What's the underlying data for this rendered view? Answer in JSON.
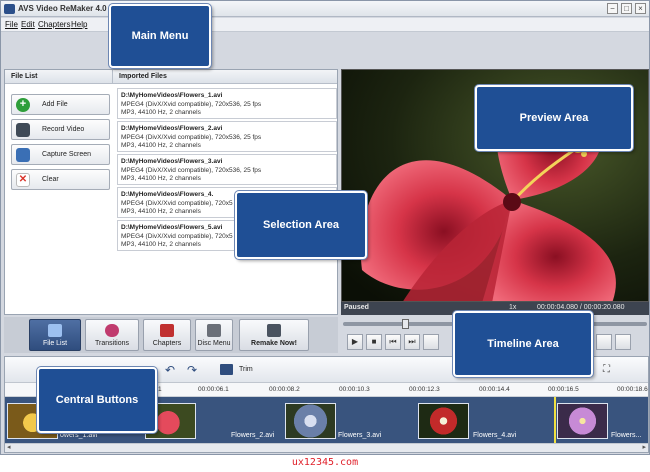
{
  "window": {
    "title": "AVS Video ReMaker 4.0",
    "minimize_glyph": "−",
    "maximize_glyph": "□",
    "close_glyph": "×"
  },
  "menu": [
    "File",
    "Edit",
    "Chapters",
    "Help"
  ],
  "file_list": {
    "header": "File List",
    "buttons": [
      {
        "label": "Add File",
        "icon": "plus-icon",
        "color": "#2e9e3a"
      },
      {
        "label": "Record Video",
        "icon": "film-icon",
        "color": "#3f4a57"
      },
      {
        "label": "Capture Screen",
        "icon": "monitor-icon",
        "color": "#3a6fb5"
      },
      {
        "label": "Clear",
        "icon": "clear-icon",
        "color": "#d9342b"
      }
    ]
  },
  "imported_files": {
    "header": "Imported Files",
    "items": [
      {
        "path": "D:\\MyHomeVideos\\Flowers_1.avi",
        "video": "MPEG4 (DivX/Xvid compatible), 720x536, 25 fps",
        "audio": "MP3, 44100 Hz, 2 channels"
      },
      {
        "path": "D:\\MyHomeVideos\\Flowers_2.avi",
        "video": "MPEG4 (DivX/Xvid compatible), 720x536, 25 fps",
        "audio": "MP3, 44100 Hz, 2 channels"
      },
      {
        "path": "D:\\MyHomeVideos\\Flowers_3.avi",
        "video": "MPEG4 (DivX/Xvid compatible), 720x536, 25 fps",
        "audio": "MP3, 44100 Hz, 2 channels"
      },
      {
        "path": "D:\\MyHomeVideos\\Flowers_4.",
        "video": "MPEG4 (DivX/Xvid compatible), 720x5",
        "audio": "MP3, 44100 Hz, 2 channels"
      },
      {
        "path": "D:\\MyHomeVideos\\Flowers_5.avi",
        "video": "MPEG4 (DivX/Xvid compatible), 720x5",
        "audio": "MP3, 44100 Hz, 2 channels"
      }
    ]
  },
  "preview": {
    "status": "Paused",
    "speed": "1x",
    "time": "00:00:04.080 / 00:00:20.080",
    "position": 0.2
  },
  "transport": [
    "▶",
    "■",
    "⏮",
    "⏭"
  ],
  "central_buttons": [
    {
      "label": "File List",
      "icon": "file-list-icon",
      "color": "#3a6fb5"
    },
    {
      "label": "Transitions",
      "icon": "transitions-icon",
      "color": "#c03b6e"
    },
    {
      "label": "Chapters",
      "icon": "chapters-icon",
      "color": "#c03030"
    },
    {
      "label": "Disc Menu",
      "icon": "disc-menu-icon",
      "color": "#6a6f78"
    },
    {
      "label": "Remake Now!",
      "icon": "remake-icon",
      "color": "#4a5360"
    }
  ],
  "timeline": {
    "trim_label": "Trim",
    "ticks": [
      "1",
      "00:00:06.1",
      "00:00:08.2",
      "00:00:10.3",
      "00:00:12.3",
      "00:00:14.4",
      "00:00:16.5",
      "00:00:18.6"
    ],
    "clips": [
      {
        "label": "owers_1.avi",
        "color": "#c9a530"
      },
      {
        "label": "Flowers_2.avi",
        "color": "#c2303f"
      },
      {
        "label": "Flowers_3.avi",
        "color": "#6a7fa8"
      },
      {
        "label": "Flowers_4.avi",
        "color": "#a52a2a"
      },
      {
        "label": "Flowers...",
        "color": "#9a5fb5"
      }
    ]
  },
  "callouts": {
    "main_menu": "Main Menu",
    "preview_area": "Preview Area",
    "selection_area": "Selection Area",
    "central_buttons": "Central Buttons",
    "timeline_area": "Timeline Area"
  },
  "watermark": "ux12345.com"
}
